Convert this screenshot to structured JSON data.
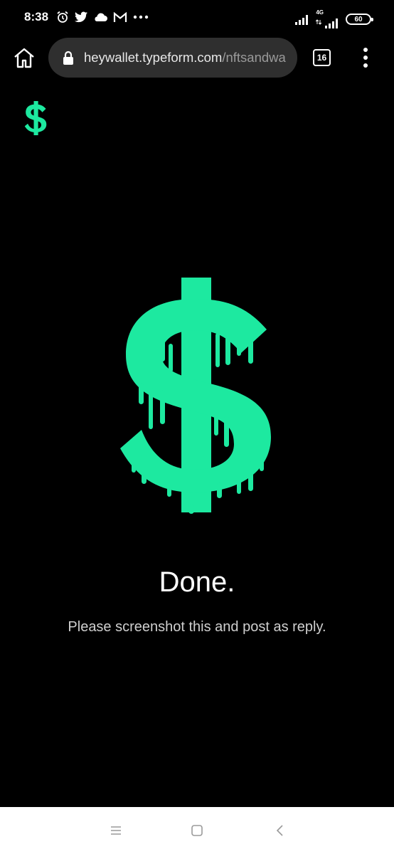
{
  "status_bar": {
    "time": "8:38",
    "left_icons": [
      "alarm-icon",
      "twitter-icon",
      "cloud-icon",
      "gmail-icon",
      "more-dots-icon"
    ],
    "network_label": "4G",
    "battery": "60"
  },
  "browser": {
    "url_host": "heywallet.typeform.com",
    "url_path": "/nftsandwa",
    "tab_count": "16"
  },
  "page": {
    "title": "Done.",
    "subtitle": "Please screenshot this and post as reply.",
    "accent_color": "#1de9a0"
  },
  "nav_bar": {
    "icons": [
      "recents-icon",
      "home-square-icon",
      "back-icon"
    ]
  }
}
